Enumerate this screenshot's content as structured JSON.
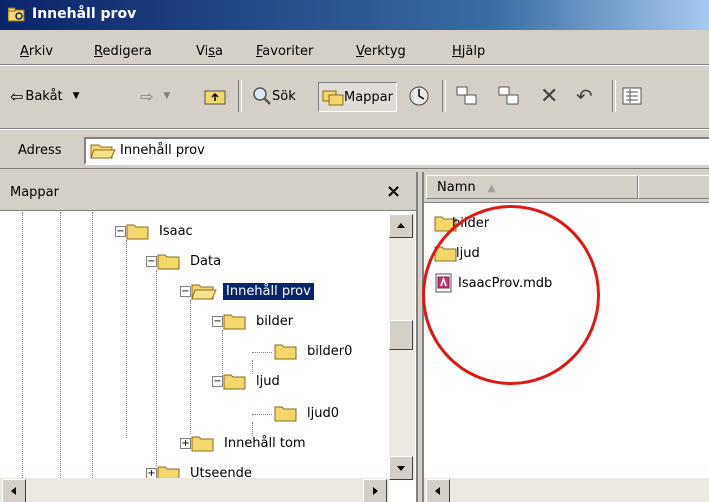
{
  "window": {
    "title": "Innehåll prov"
  },
  "menu": [
    {
      "pre": "",
      "u": "A",
      "post": "rkiv"
    },
    {
      "pre": "",
      "u": "R",
      "post": "edigera"
    },
    {
      "pre": "Vi",
      "u": "s",
      "post": "a"
    },
    {
      "pre": "",
      "u": "F",
      "post": "avoriter"
    },
    {
      "pre": "",
      "u": "V",
      "post": "erktyg"
    },
    {
      "pre": "",
      "u": "H",
      "post": "jälp"
    }
  ],
  "toolbar": {
    "back_label": "Bakåt",
    "search_label": "Sök",
    "folders_label": "Mappar"
  },
  "address": {
    "label": "Adress",
    "value": "Innehåll prov"
  },
  "folders_pane": {
    "title": "Mappar",
    "close": "×",
    "tree": [
      {
        "label": "Isaac",
        "expander": "−"
      },
      {
        "label": "Data",
        "expander": "−"
      },
      {
        "label": "Innehåll prov",
        "expander": "−",
        "selected": true
      },
      {
        "label": "bilder",
        "expander": "−"
      },
      {
        "label": "bilder0",
        "expander": ""
      },
      {
        "label": "ljud",
        "expander": "−"
      },
      {
        "label": "ljud0",
        "expander": ""
      },
      {
        "label": "Innehåll tom",
        "expander": "+"
      },
      {
        "label": "Utseende",
        "expander": "+"
      }
    ]
  },
  "file_list": {
    "column_name": "Namn",
    "sort_indicator": "▲",
    "items": [
      {
        "name": "bilder",
        "type": "folder"
      },
      {
        "name": "ljud",
        "type": "folder"
      },
      {
        "name": "IsaacProv.mdb",
        "type": "access-db"
      }
    ]
  },
  "colors": {
    "selection": "#0a246a",
    "annotation_circle": "#e01818",
    "folder_yellow": "#f3d76b"
  }
}
